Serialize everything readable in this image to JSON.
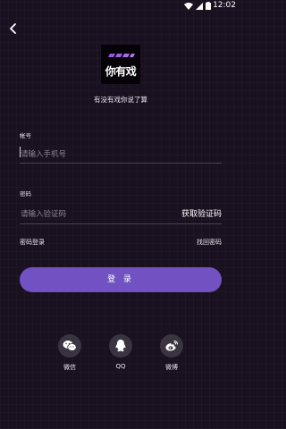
{
  "status_bar": {
    "time": "12:02"
  },
  "logo": {
    "text": "你有戏"
  },
  "slogan": "有没有戏你说了算",
  "account": {
    "label": "帐号",
    "placeholder": "请输入手机号"
  },
  "password": {
    "label": "密码",
    "placeholder": "请输入验证码",
    "get_code": "获取验证码"
  },
  "links": {
    "password_login": "密码登录",
    "recover_password": "找回密码"
  },
  "login_button": "登 录",
  "social": [
    {
      "name": "微信",
      "icon": "wechat-icon"
    },
    {
      "name": "QQ",
      "icon": "qq-icon"
    },
    {
      "name": "微博",
      "icon": "weibo-icon"
    }
  ],
  "colors": {
    "background": "#1a1120",
    "accent": "#7251c2"
  }
}
